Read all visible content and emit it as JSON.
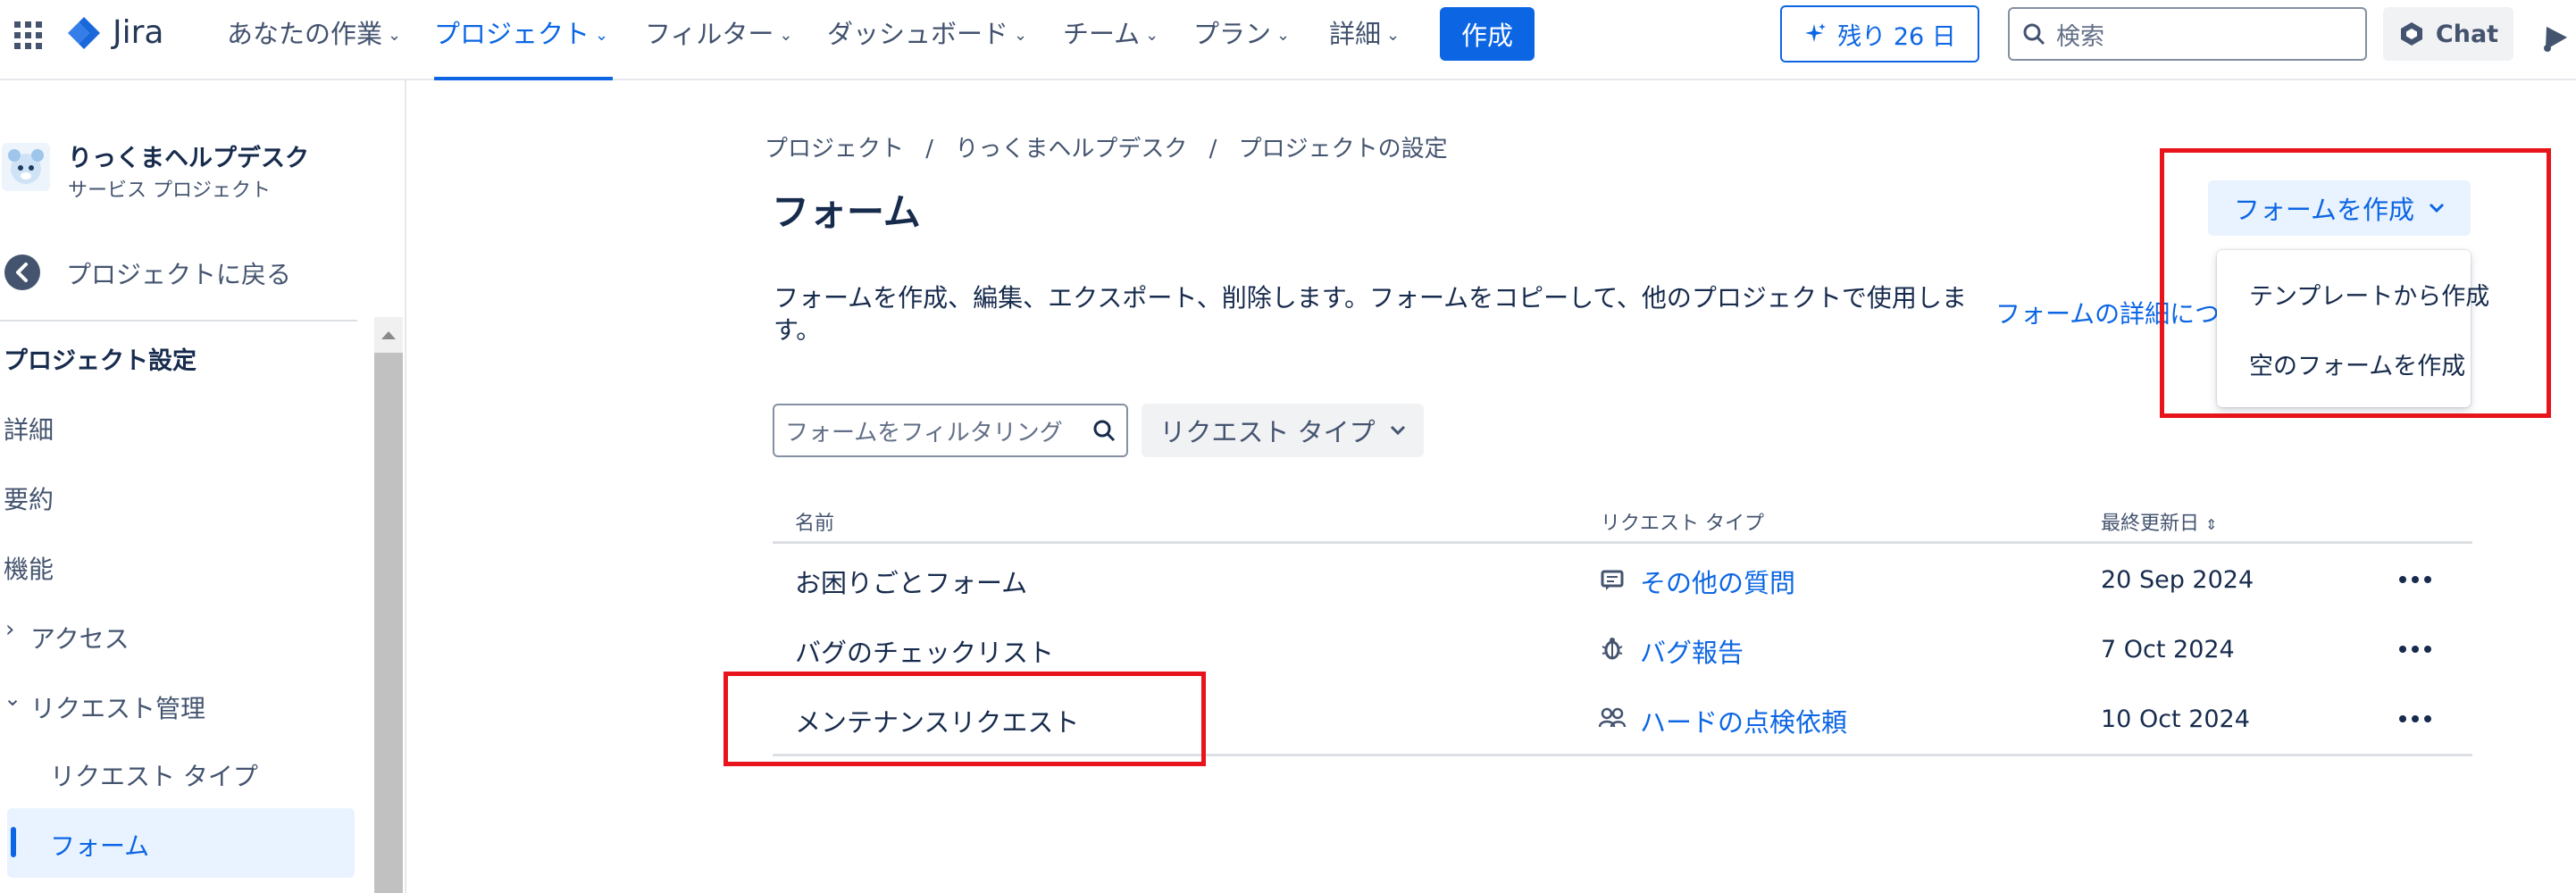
{
  "topbar": {
    "app_name": "Jira",
    "nav": [
      {
        "label": "あなたの作業"
      },
      {
        "label": "プロジェクト"
      },
      {
        "label": "フィルター"
      },
      {
        "label": "ダッシュボード"
      },
      {
        "label": "チーム"
      },
      {
        "label": "プラン"
      },
      {
        "label": "詳細"
      }
    ],
    "create_label": "作成",
    "trial_label": "残り 26 日",
    "search_placeholder": "検索",
    "chat_label": "Chat"
  },
  "sidebar": {
    "project_name": "りっくまヘルプデスク",
    "project_type": "サービス プロジェクト",
    "back_label": "プロジェクトに戻る",
    "section_title": "プロジェクト設定",
    "items": [
      {
        "label": "詳細"
      },
      {
        "label": "要約"
      },
      {
        "label": "機能"
      },
      {
        "label": "アクセス"
      },
      {
        "label": "リクエスト管理"
      },
      {
        "label": "リクエスト タイプ"
      },
      {
        "label": "フォーム"
      }
    ]
  },
  "breadcrumb": [
    "プロジェクト",
    "りっくまヘルプデスク",
    "プロジェクトの設定"
  ],
  "breadcrumb_sep": "/",
  "page_title": "フォーム",
  "description_line1": "フォームを作成、編集、エクスポート、削除します。フォームをコピーして、他のプロジェクトで使用しま",
  "description_line2": "す。",
  "learn_more": "フォームの詳細につ",
  "create_form_button": "フォームを作成",
  "create_menu": [
    "テンプレートから作成",
    "空のフォームを作成"
  ],
  "filter_placeholder": "フォームをフィルタリング",
  "request_type_filter": "リクエスト タイプ",
  "table": {
    "headers": {
      "name": "名前",
      "request_type": "リクエスト タイプ",
      "updated": "最終更新日"
    },
    "sort_icon": "sort-icon",
    "rows": [
      {
        "name": "お困りごとフォーム",
        "request_type": "その他の質問",
        "icon": "message-icon",
        "updated": "20 Sep 2024"
      },
      {
        "name": "バグのチェックリスト",
        "request_type": "バグ報告",
        "icon": "bug-icon",
        "updated": "7 Oct 2024"
      },
      {
        "name": "メンテナンスリクエスト",
        "request_type": "ハードの点検依頼",
        "icon": "people-icon",
        "updated": "10 Oct 2024"
      }
    ]
  },
  "colors": {
    "accent": "#0c66e4",
    "highlight_box": "#e8141b",
    "selected_bg": "#e9f2ff"
  }
}
